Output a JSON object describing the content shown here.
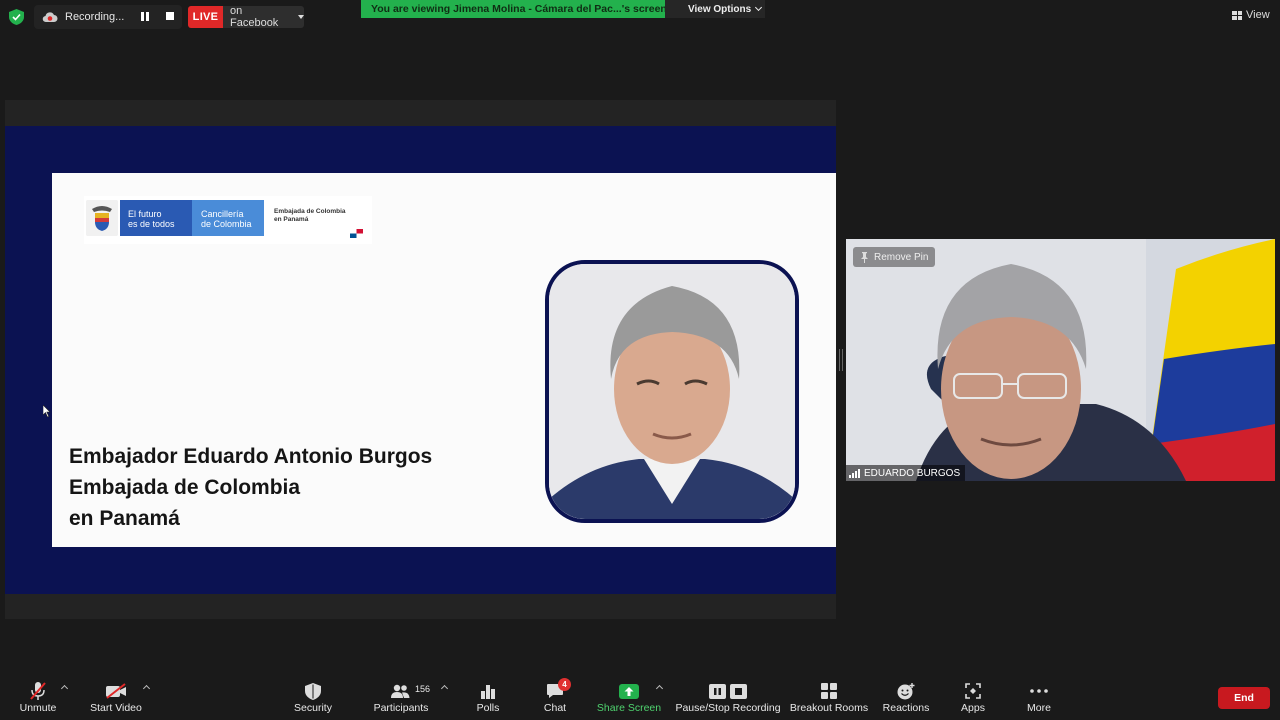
{
  "top_bar": {
    "recording_label": "Recording...",
    "live_badge": "LIVE",
    "live_target": "on Facebook",
    "viewing_banner": "You are viewing Jimena Molina - Cámara del Pac...'s screen",
    "view_options": "View Options",
    "view_button": "View"
  },
  "slide": {
    "logo_line1": "El futuro",
    "logo_line2": "es de todos",
    "logo_ministry_line1": "Cancillería",
    "logo_ministry_line2": "de Colombia",
    "logo_embassy_line1": "Embajada de Colombia",
    "logo_embassy_line2": "en Panamá",
    "title_line1": "Embajador Eduardo Antonio Burgos",
    "title_line2": "Embajada de Colombia",
    "title_line3": "en Panamá"
  },
  "video": {
    "remove_pin": "Remove Pin",
    "participant_name": "EDUARDO BURGOS"
  },
  "toolbar": {
    "unmute": "Unmute",
    "start_video": "Start Video",
    "security": "Security",
    "participants": "Participants",
    "participants_count": "156",
    "polls": "Polls",
    "chat": "Chat",
    "chat_badge": "4",
    "share_screen": "Share Screen",
    "pause_stop_recording": "Pause/Stop Recording",
    "breakout_rooms": "Breakout Rooms",
    "reactions": "Reactions",
    "apps": "Apps",
    "more": "More",
    "end": "End"
  },
  "colors": {
    "accent_green": "#23b14d",
    "live_red": "#e02828",
    "end_red": "#c8191f",
    "slide_navy": "#0b1252"
  }
}
